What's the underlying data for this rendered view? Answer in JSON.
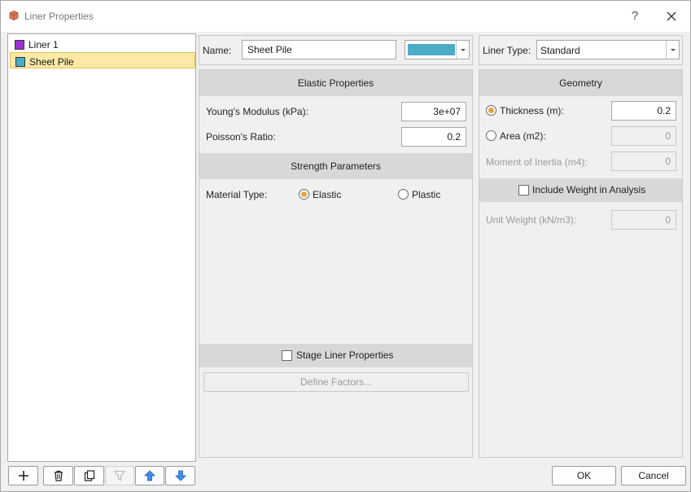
{
  "window": {
    "title": "Liner Properties",
    "help_label": "?"
  },
  "liners": [
    {
      "label": "Liner 1",
      "color": "#9b30d9",
      "selected": false
    },
    {
      "label": "Sheet Pile",
      "color": "#4bacc6",
      "selected": true
    }
  ],
  "toolbar": {
    "icons": [
      "add-icon",
      "delete-icon",
      "copy-icon",
      "filter-icon",
      "move-up-icon",
      "move-down-icon"
    ]
  },
  "name_row": {
    "label": "Name:",
    "value": "Sheet Pile",
    "color": "#4bacc6"
  },
  "liner_type": {
    "label": "Liner Type:",
    "value": "Standard"
  },
  "elastic": {
    "header": "Elastic Properties",
    "youngs_label": "Young's Modulus (kPa):",
    "youngs_value": "3e+07",
    "poisson_label": "Poisson's Ratio:",
    "poisson_value": "0.2"
  },
  "strength": {
    "header": "Strength Parameters",
    "material_label": "Material Type:",
    "option_elastic": "Elastic",
    "option_plastic": "Plastic",
    "selected": "Elastic"
  },
  "stage": {
    "label": "Stage Liner Properties",
    "checked": false,
    "define_factors": "Define Factors..."
  },
  "geometry": {
    "header": "Geometry",
    "thickness_label": "Thickness (m):",
    "thickness_value": "0.2",
    "area_label": "Area (m2):",
    "area_value": "0",
    "inertia_label": "Moment of Inertia (m4):",
    "inertia_value": "0",
    "selected": "Thickness"
  },
  "weight": {
    "include_label": "Include Weight in Analysis",
    "checked": false,
    "unit_weight_label": "Unit Weight (kN/m3):",
    "unit_weight_value": "0"
  },
  "buttons": {
    "ok": "OK",
    "cancel": "Cancel"
  },
  "colors": {
    "accent": "#e8a53c",
    "selection": "#fbe9a6"
  }
}
